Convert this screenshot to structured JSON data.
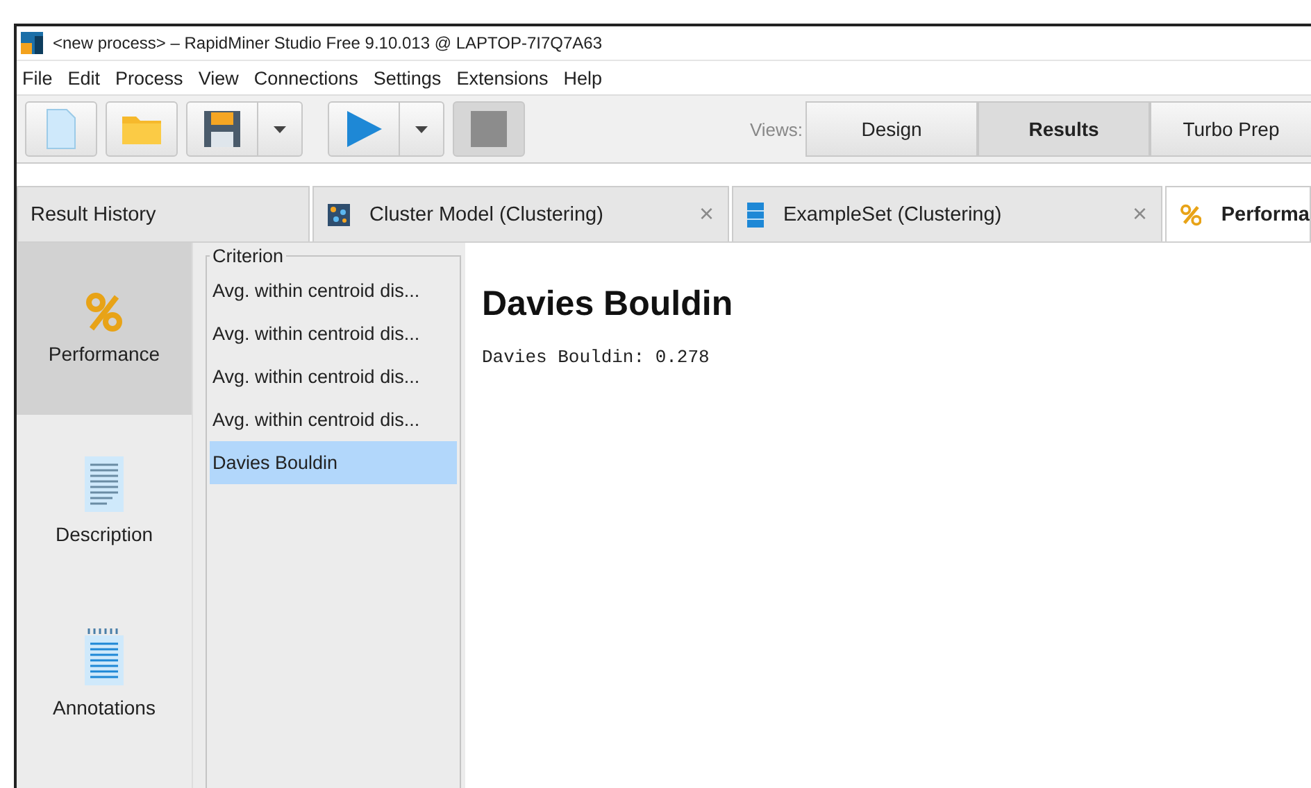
{
  "window": {
    "title": "<new process> – RapidMiner Studio Free 9.10.013 @ LAPTOP-7I7Q7A63"
  },
  "menu": [
    "File",
    "Edit",
    "Process",
    "View",
    "Connections",
    "Settings",
    "Extensions",
    "Help"
  ],
  "toolbar": {
    "views_label": "Views:",
    "views": [
      {
        "label": "Design",
        "selected": false
      },
      {
        "label": "Results",
        "selected": true
      },
      {
        "label": "Turbo Prep",
        "selected": false
      }
    ]
  },
  "result_history": {
    "label": "Result History"
  },
  "tabs": [
    {
      "label": "Cluster Model (Clustering)",
      "kind": "cluster",
      "selected": false,
      "close": "×"
    },
    {
      "label": "ExampleSet (Clustering)",
      "kind": "table",
      "selected": false,
      "close": "×"
    },
    {
      "label": "Performa",
      "kind": "percent",
      "selected": true
    }
  ],
  "side_views": [
    {
      "label": "Performance",
      "kind": "percent",
      "selected": true
    },
    {
      "label": "Description",
      "kind": "doc",
      "selected": false
    },
    {
      "label": "Annotations",
      "kind": "notes",
      "selected": false
    }
  ],
  "criterion": {
    "title": "Criterion",
    "items": [
      {
        "label": "Avg. within centroid dis...",
        "selected": false
      },
      {
        "label": "Avg. within centroid dis...",
        "selected": false
      },
      {
        "label": "Avg. within centroid dis...",
        "selected": false
      },
      {
        "label": "Avg. within centroid dis...",
        "selected": false
      },
      {
        "label": "Davies Bouldin",
        "selected": true
      }
    ]
  },
  "result": {
    "heading": "Davies Bouldin",
    "text": "Davies Bouldin: 0.278"
  }
}
